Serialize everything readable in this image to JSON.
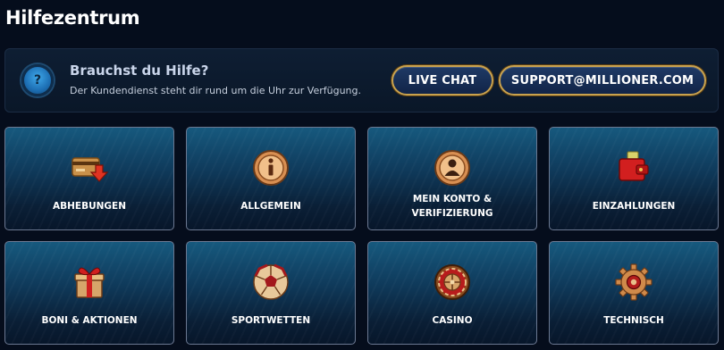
{
  "page": {
    "title": "Hilfezentrum"
  },
  "help": {
    "title": "Brauchst du Hilfe?",
    "subtitle": "Der Kundendienst steht dir rund um die Uhr zur Verfügung.",
    "icon": "question-icon",
    "icon_glyph": "?",
    "live_chat_label": "LIVE CHAT",
    "email_label": "SUPPORT@MILLIONER.COM"
  },
  "colors": {
    "background": "#050d1c",
    "banner": "#0e1e33",
    "accent_gold": "#c9a24e",
    "button_blue": "#1f3a66",
    "card_top": "#16597e",
    "card_bottom": "#07162a"
  },
  "categories": [
    {
      "label": "ABHEBUNGEN",
      "icon": "withdrawal-card-icon"
    },
    {
      "label": "ALLGEMEIN",
      "icon": "info-icon"
    },
    {
      "label": "MEIN KONTO & VERIFIZIERUNG",
      "icon": "account-icon"
    },
    {
      "label": "EINZAHLUNGEN",
      "icon": "wallet-icon"
    },
    {
      "label": "BONI & AKTIONEN",
      "icon": "gift-icon"
    },
    {
      "label": "SPORTWETTEN",
      "icon": "soccer-ball-icon"
    },
    {
      "label": "CASINO",
      "icon": "roulette-icon"
    },
    {
      "label": "TECHNISCH",
      "icon": "gear-icon"
    }
  ]
}
